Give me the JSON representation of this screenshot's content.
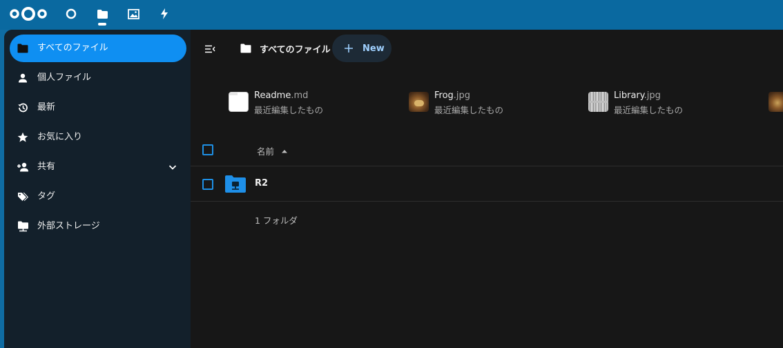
{
  "topbar": {
    "apps": [
      {
        "name": "dashboard",
        "icon": "circle-icon"
      },
      {
        "name": "files",
        "icon": "folder-icon",
        "active": true
      },
      {
        "name": "photos",
        "icon": "image-icon"
      },
      {
        "name": "activity",
        "icon": "bolt-icon"
      }
    ]
  },
  "sidebar": {
    "items": [
      {
        "label": "すべてのファイル",
        "icon": "folder-icon",
        "active": true
      },
      {
        "label": "個人ファイル",
        "icon": "user-icon"
      },
      {
        "label": "最新",
        "icon": "history-icon"
      },
      {
        "label": "お気に入り",
        "icon": "star-icon"
      },
      {
        "label": "共有",
        "icon": "share-user-icon",
        "expandable": true
      },
      {
        "label": "タグ",
        "icon": "tag-icon"
      },
      {
        "label": "外部ストレージ",
        "icon": "network-folder-icon"
      }
    ]
  },
  "toolbar": {
    "breadcrumb": "すべてのファイル",
    "new_label": "New"
  },
  "recent": [
    {
      "base": "Readme",
      "ext": ".md",
      "sub": "最近編集したもの",
      "thumb": "text-file"
    },
    {
      "base": "Frog",
      "ext": ".jpg",
      "sub": "最近編集したもの",
      "thumb": "frog-photo"
    },
    {
      "base": "Library",
      "ext": ".jpg",
      "sub": "最近編集したもの",
      "thumb": "library-photo"
    }
  ],
  "table": {
    "header_name": "名前",
    "rows": [
      {
        "name": "R2",
        "icon": "external-folder-icon"
      }
    ],
    "summary": "1 フォルダ"
  },
  "colors": {
    "topbar": "#0a69a0",
    "accent": "#0f8ff2",
    "sidebar": "#13202b",
    "main": "#171717"
  }
}
